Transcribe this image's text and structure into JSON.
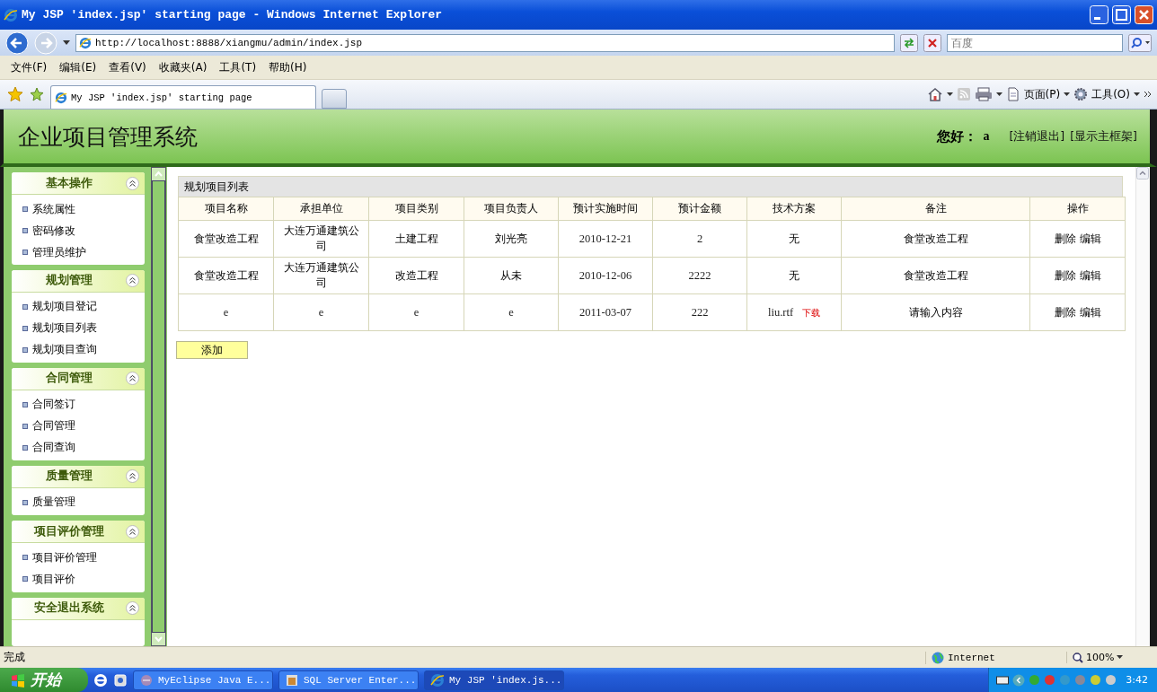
{
  "window": {
    "title": "My JSP 'index.jsp' starting page - Windows Internet Explorer"
  },
  "address_bar": {
    "url": "http://localhost:8888/xiangmu/admin/index.jsp"
  },
  "search": {
    "placeholder": "百度"
  },
  "menu_bar": [
    "文件(F)",
    "编辑(E)",
    "查看(V)",
    "收藏夹(A)",
    "工具(T)",
    "帮助(H)"
  ],
  "tabs": [
    {
      "label": "My JSP 'index.jsp' starting page",
      "selected": true
    }
  ],
  "command_bar": [
    "页面(P)",
    "工具(O)"
  ],
  "app": {
    "title": "企业项目管理系统",
    "greeting": "您好：",
    "user": "a",
    "links": [
      "[注销退出]",
      "[显示主框架]"
    ]
  },
  "sidebar": {
    "groups": [
      {
        "title": "基本操作",
        "expanded": true,
        "items": [
          "系统属性",
          "密码修改",
          "管理员维护"
        ]
      },
      {
        "title": "规划管理",
        "expanded": true,
        "items": [
          "规划项目登记",
          "规划项目列表",
          "规划项目查询"
        ]
      },
      {
        "title": "合同管理",
        "expanded": true,
        "items": [
          "合同签订",
          "合同管理",
          "合同查询"
        ]
      },
      {
        "title": "质量管理",
        "expanded": true,
        "items": [
          "质量管理"
        ]
      },
      {
        "title": "项目评价管理",
        "expanded": true,
        "items": [
          "项目评价管理",
          "项目评价"
        ]
      },
      {
        "title": "安全退出系统",
        "expanded": true
      }
    ]
  },
  "table": {
    "title": "规划项目列表",
    "columns": [
      "项目名称",
      "承担单位",
      "项目类别",
      "项目负责人",
      "预计实施时间",
      "预计金额",
      "技术方案",
      "备注",
      "操作"
    ],
    "rows": [
      {
        "cells": [
          "食堂改造工程",
          "大连万通建筑公司",
          "土建工程",
          "刘光亮",
          "2010-12-21",
          "2",
          "无",
          "食堂改造工程"
        ],
        "actions": [
          "删除",
          "编辑"
        ]
      },
      {
        "cells": [
          "食堂改造工程",
          "大连万通建筑公司",
          "改造工程",
          "从未",
          "2010-12-06",
          "2222",
          "无",
          "食堂改造工程"
        ],
        "actions": [
          "删除",
          "编辑"
        ]
      },
      {
        "cells": [
          "e",
          "e",
          "e",
          "e",
          "2011-03-07",
          "222",
          "liu.rtf",
          "请输入内容"
        ],
        "download": "下载",
        "actions": [
          "删除",
          "编辑"
        ]
      }
    ]
  },
  "add_button": "添加",
  "status_bar": {
    "text": "完成",
    "zone": "Internet",
    "zoom": "100%"
  },
  "taskbar": {
    "start": "开始",
    "tasks": [
      {
        "label": "MyEclipse Java E...",
        "selected": false
      },
      {
        "label": "SQL Server Enter...",
        "selected": false
      },
      {
        "label": "My JSP 'index.js...",
        "selected": true
      }
    ],
    "clock": "3:42"
  }
}
